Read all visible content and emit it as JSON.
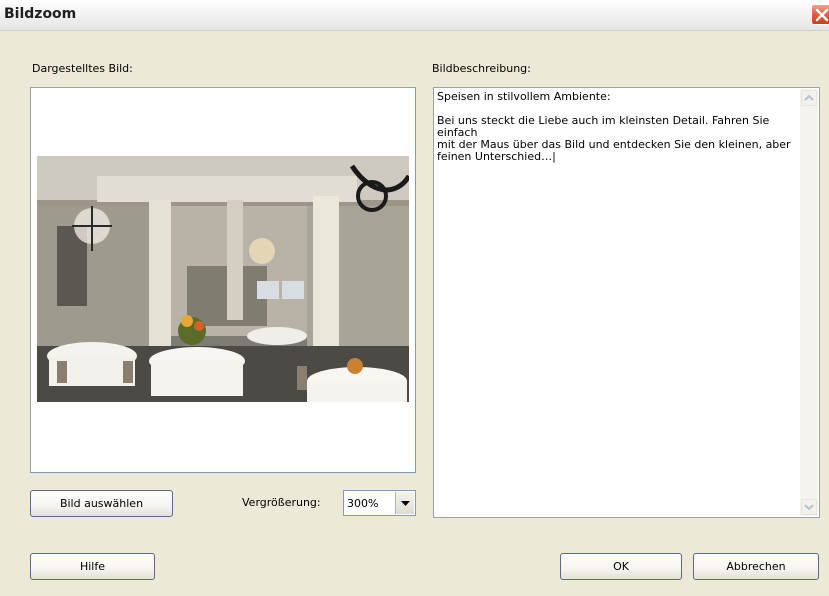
{
  "window": {
    "title": "Bildzoom"
  },
  "left": {
    "label": "Dargestelltes Bild:",
    "choose_button": "Bild auswählen",
    "zoom_label": "Vergrößerung:",
    "zoom_value": "300%"
  },
  "right": {
    "label": "Bildbeschreibung:",
    "description": "Speisen in stilvollem Ambiente:\n\nBei uns steckt die Liebe auch im kleinsten Detail. Fahren Sie einfach\nmit der Maus über das Bild und entdecken Sie den kleinen, aber\nfeinen Unterschied…|"
  },
  "footer": {
    "help_button": "Hilfe",
    "ok_button": "OK",
    "cancel_button": "Abbrechen"
  },
  "icons": {
    "close": "close-icon",
    "dropdown": "chevron-down-icon",
    "scroll_up": "scroll-up-icon",
    "scroll_down": "scroll-down-icon"
  }
}
